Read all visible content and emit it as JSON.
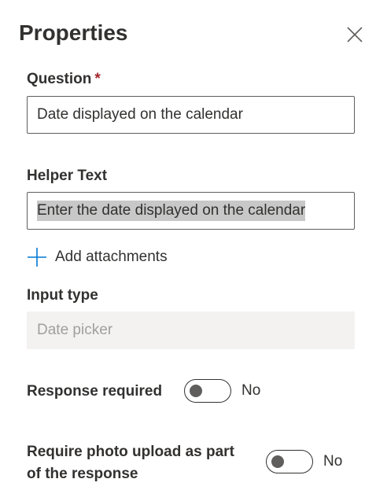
{
  "panel": {
    "title": "Properties",
    "close_icon": "close-icon"
  },
  "question": {
    "label": "Question",
    "required_marker": "*",
    "value": "Date displayed on the calendar"
  },
  "helper_text": {
    "label": "Helper Text",
    "value": "Enter the date displayed on the calendar"
  },
  "attachments": {
    "icon": "plus-icon",
    "label": "Add attachments",
    "accent_color": "#0078d4"
  },
  "input_type": {
    "label": "Input type",
    "value": "Date picker"
  },
  "response_required": {
    "label": "Response required",
    "state_text": "No",
    "checked": false
  },
  "photo_upload": {
    "label_line1": "Require photo upload as part",
    "label_line2": "of the response",
    "state_text": "No",
    "checked": false
  }
}
